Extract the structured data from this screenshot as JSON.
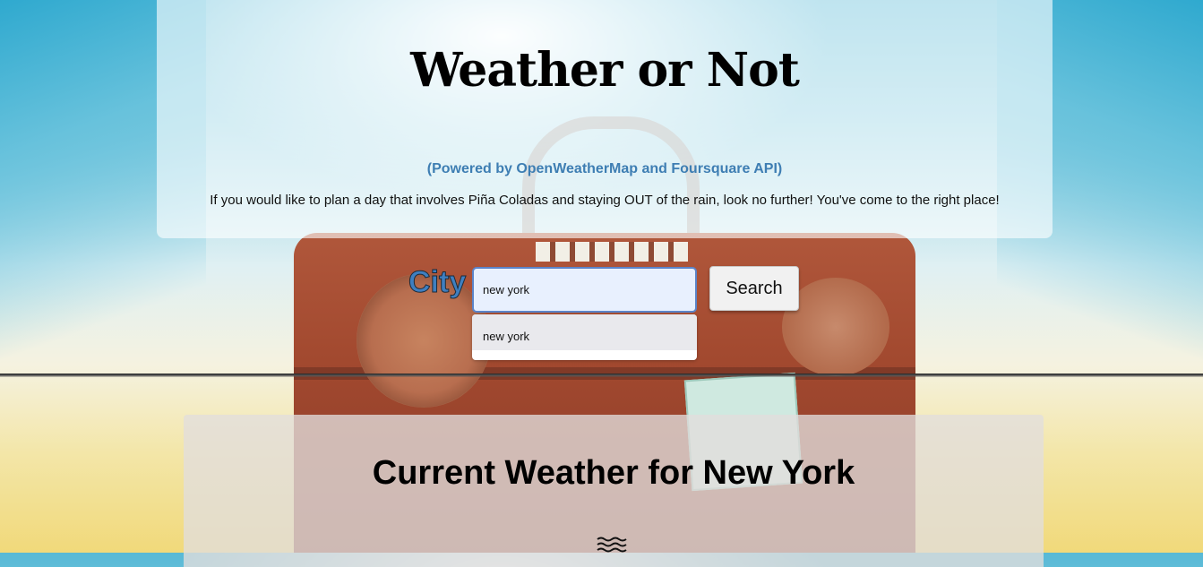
{
  "header": {
    "title": "Weather or Not",
    "subtitle": "(Powered by OpenWeatherMap and Foursquare API)",
    "tagline": "If you would like to plan a day that involves Piña Coladas and staying OUT of the rain, look no further! You've come to the right place!"
  },
  "search": {
    "label": "City",
    "value": "new york",
    "suggestion": "new york",
    "button_label": "Search"
  },
  "weather": {
    "title": "Current Weather for New York",
    "icon": "wind-waves-icon"
  },
  "colors": {
    "subtitle": "#3e7eb3",
    "city_label": "#3f7fc0",
    "input_border": "#5b84c9",
    "input_background": "#e8f0fe"
  }
}
